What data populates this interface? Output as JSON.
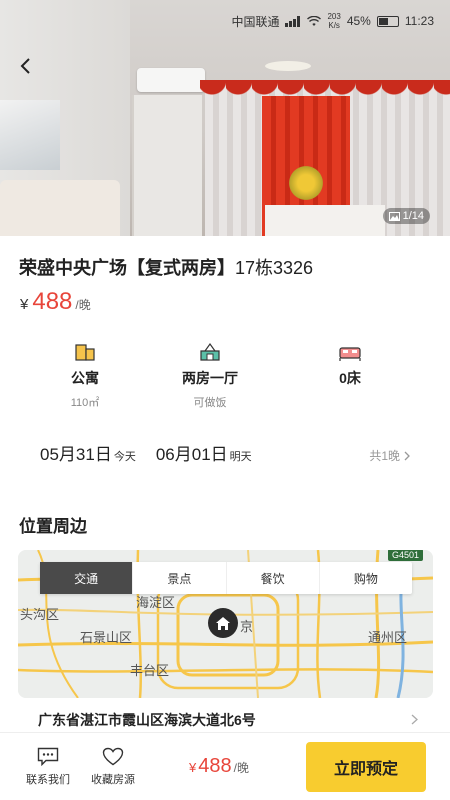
{
  "status_bar": {
    "carrier": "中国联通",
    "network_speed": "203\nK/s",
    "battery": "45%",
    "time": "11:23"
  },
  "gallery": {
    "counter": "1/14"
  },
  "listing": {
    "title": "荣盛中央广场【复式两房】",
    "title_suffix": "17栋3326",
    "currency": "¥",
    "price": "488",
    "price_unit": "/晚"
  },
  "features": [
    {
      "icon": "apartment-icon",
      "label": "公寓",
      "sub": "110㎡"
    },
    {
      "icon": "room-layout-icon",
      "label": "两房一厅",
      "sub": "可做饭"
    },
    {
      "icon": "bed-icon",
      "label": "0床",
      "sub": ""
    }
  ],
  "dates": {
    "checkin_date": "05月31日",
    "checkin_weekday": "今天",
    "checkout_date": "06月01日",
    "checkout_weekday": "明天",
    "nights": "共1晚"
  },
  "location": {
    "section_title": "位置周边",
    "tabs": [
      "交通",
      "景点",
      "餐饮",
      "购物"
    ],
    "active_tab": 0,
    "map_labels": [
      "海淀区",
      "头沟区",
      "石景山区",
      "丰台区",
      "通州区",
      "京"
    ],
    "highway": "G4501",
    "address": "广东省湛江市霞山区海滨大道北6号"
  },
  "bottom_bar": {
    "contact_label": "联系我们",
    "favorite_label": "收藏房源",
    "currency": "¥",
    "price": "488",
    "price_unit": "/晚",
    "book_label": "立即预定"
  },
  "colors": {
    "price_red": "#e8453a",
    "accent_yellow": "#f8cc2f",
    "active_tab_bg": "#4a4a4a"
  }
}
